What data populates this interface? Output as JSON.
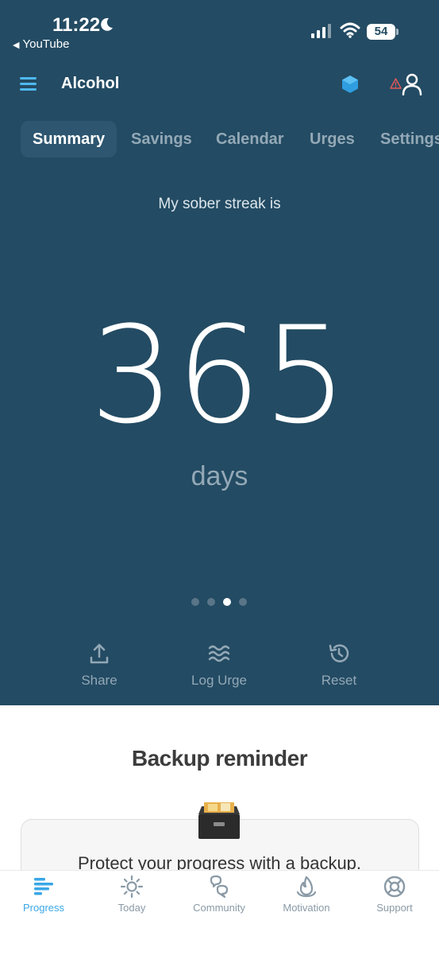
{
  "status_bar": {
    "time": "11:22",
    "back_app": "YouTube",
    "battery": "54"
  },
  "header": {
    "title": "Alcohol"
  },
  "tabs": [
    {
      "label": "Summary",
      "active": true
    },
    {
      "label": "Savings",
      "active": false
    },
    {
      "label": "Calendar",
      "active": false
    },
    {
      "label": "Urges",
      "active": false
    },
    {
      "label": "Settings",
      "active": false
    }
  ],
  "streak": {
    "label": "My sober streak is",
    "value": "365",
    "unit": "days"
  },
  "pager": {
    "count": 4,
    "active_index": 2
  },
  "actions": [
    {
      "label": "Share",
      "icon": "share-icon"
    },
    {
      "label": "Log Urge",
      "icon": "waves-icon"
    },
    {
      "label": "Reset",
      "icon": "history-icon"
    }
  ],
  "backup": {
    "title": "Backup reminder",
    "text": "Protect your progress with a backup."
  },
  "bottom_nav": [
    {
      "label": "Progress",
      "icon": "progress-icon",
      "active": true
    },
    {
      "label": "Today",
      "icon": "sun-icon",
      "active": false
    },
    {
      "label": "Community",
      "icon": "chat-bubbles-icon",
      "active": false
    },
    {
      "label": "Motivation",
      "icon": "flame-icon",
      "active": false
    },
    {
      "label": "Support",
      "icon": "lifebuoy-icon",
      "active": false
    }
  ],
  "colors": {
    "background": "#234b63",
    "accent": "#3aa7e6",
    "muted": "#93a8b6",
    "active_tab_bg": "#2e5670"
  }
}
